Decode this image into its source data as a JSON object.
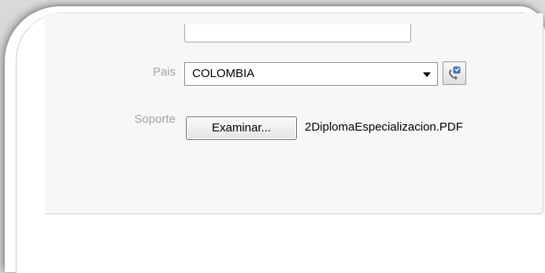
{
  "form": {
    "pais": {
      "label": "Pais",
      "selected": "COLOMBIA"
    },
    "soporte": {
      "label": "Soporte",
      "browse_label": "Examinar...",
      "file_name": "2DiplomaEspecializacion.PDF"
    }
  },
  "icons": {
    "refresh": "refresh-icon",
    "dropdown": "chevron-down-icon"
  }
}
